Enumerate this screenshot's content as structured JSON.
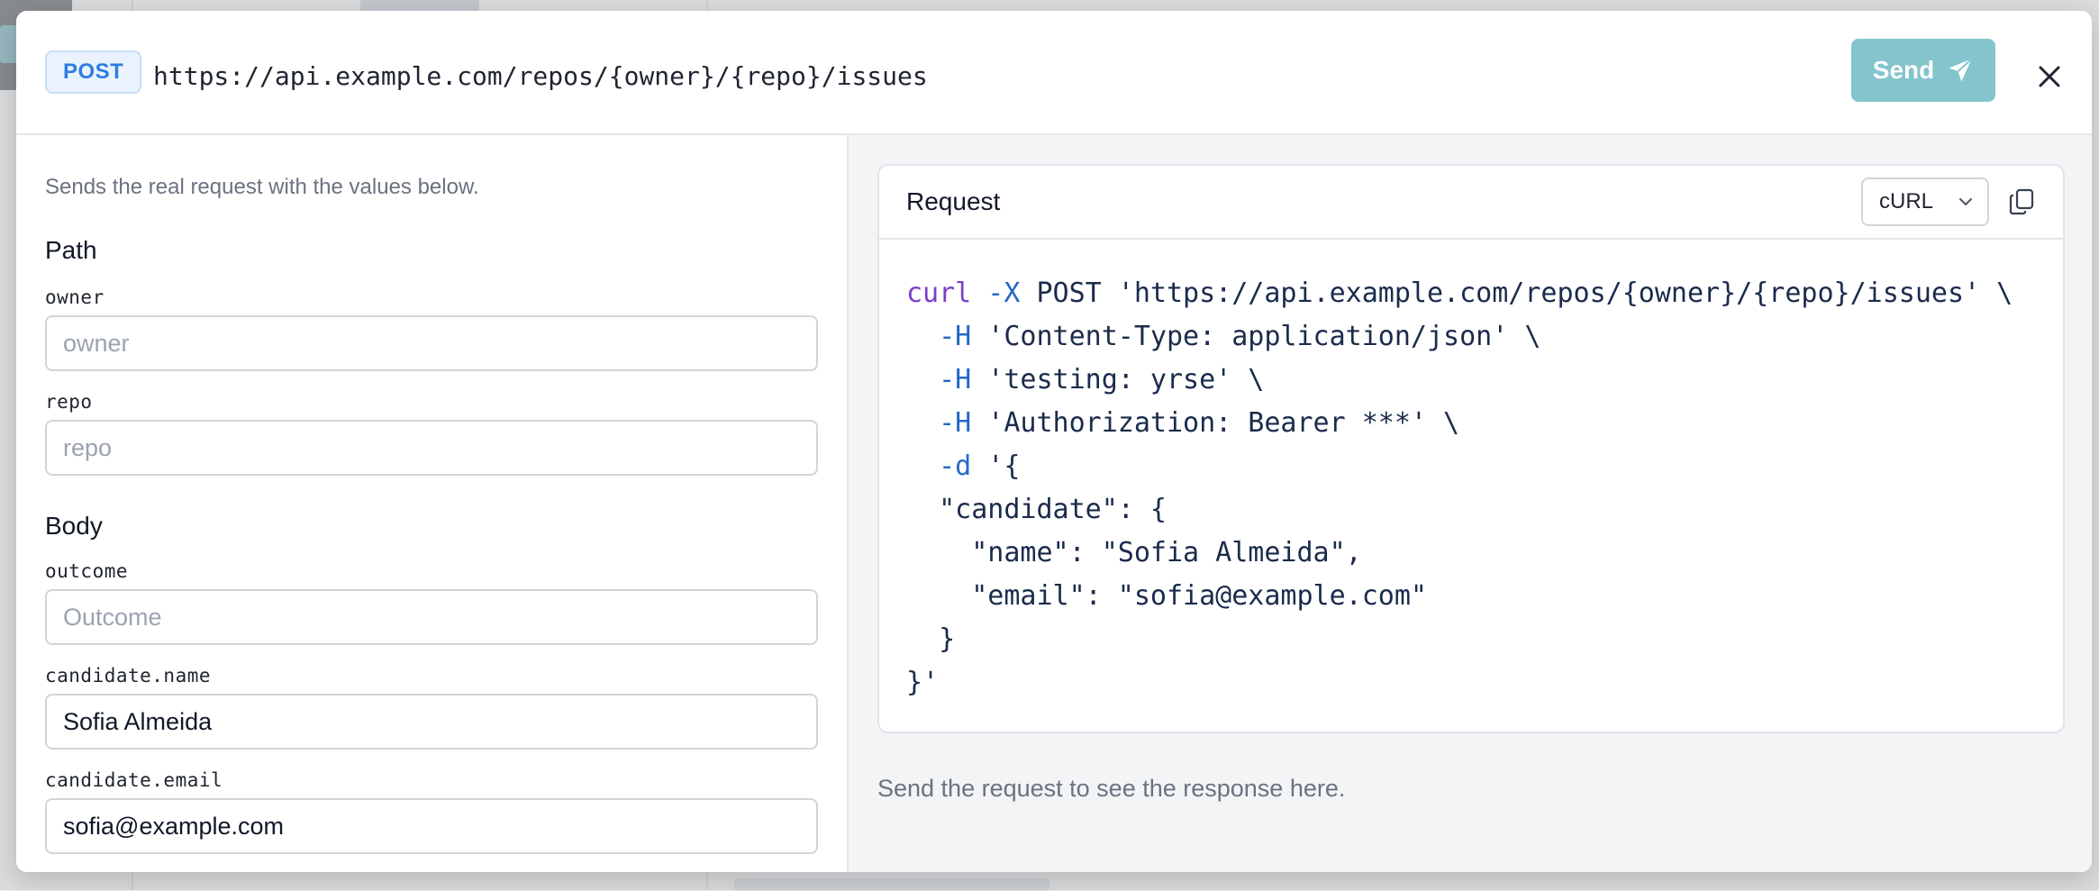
{
  "request": {
    "method": "POST",
    "url": "https://api.example.com/repos/{owner}/{repo}/issues",
    "send_label": "Send"
  },
  "left_panel": {
    "hint": "Sends the real request with the values below.",
    "sections": {
      "path": {
        "title": "Path",
        "fields": [
          {
            "label": "owner",
            "value": "",
            "placeholder": "owner"
          },
          {
            "label": "repo",
            "value": "",
            "placeholder": "repo"
          }
        ]
      },
      "body": {
        "title": "Body",
        "fields": [
          {
            "label": "outcome",
            "value": "",
            "placeholder": "Outcome"
          },
          {
            "label": "candidate.name",
            "value": "Sofia Almeida",
            "placeholder": ""
          },
          {
            "label": "candidate.email",
            "value": "sofia@example.com",
            "placeholder": ""
          }
        ]
      }
    }
  },
  "request_card": {
    "title": "Request",
    "language": "cURL",
    "code_lines": [
      {
        "cmd": "curl",
        "flag": " -X",
        "rest": " POST 'https://api.example.com/repos/{owner}/{repo}/issues' \\"
      },
      {
        "cmd": "",
        "flag": "  -H",
        "rest": " 'Content-Type: application/json' \\"
      },
      {
        "cmd": "",
        "flag": "  -H",
        "rest": " 'testing: yrse' \\"
      },
      {
        "cmd": "",
        "flag": "  -H",
        "rest": " 'Authorization: Bearer ***' \\"
      },
      {
        "cmd": "",
        "flag": "  -d",
        "rest": " '{"
      },
      {
        "cmd": "",
        "flag": "",
        "rest": "  \"candidate\": {"
      },
      {
        "cmd": "",
        "flag": "",
        "rest": "    \"name\": \"Sofia Almeida\","
      },
      {
        "cmd": "",
        "flag": "",
        "rest": "    \"email\": \"sofia@example.com\""
      },
      {
        "cmd": "",
        "flag": "",
        "rest": "  }"
      },
      {
        "cmd": "",
        "flag": "",
        "rest": "}'"
      }
    ]
  },
  "response": {
    "hint": "Send the request to see the response here."
  },
  "colors": {
    "send_button": "#84c4cd",
    "method_badge": "#2f7de0",
    "code_command": "#7b3fc9",
    "code_flag": "#2468c4"
  },
  "icons": {
    "send": "paper-plane-icon",
    "close": "close-icon",
    "dropdown": "chevron-down-icon",
    "copy": "copy-icon"
  }
}
